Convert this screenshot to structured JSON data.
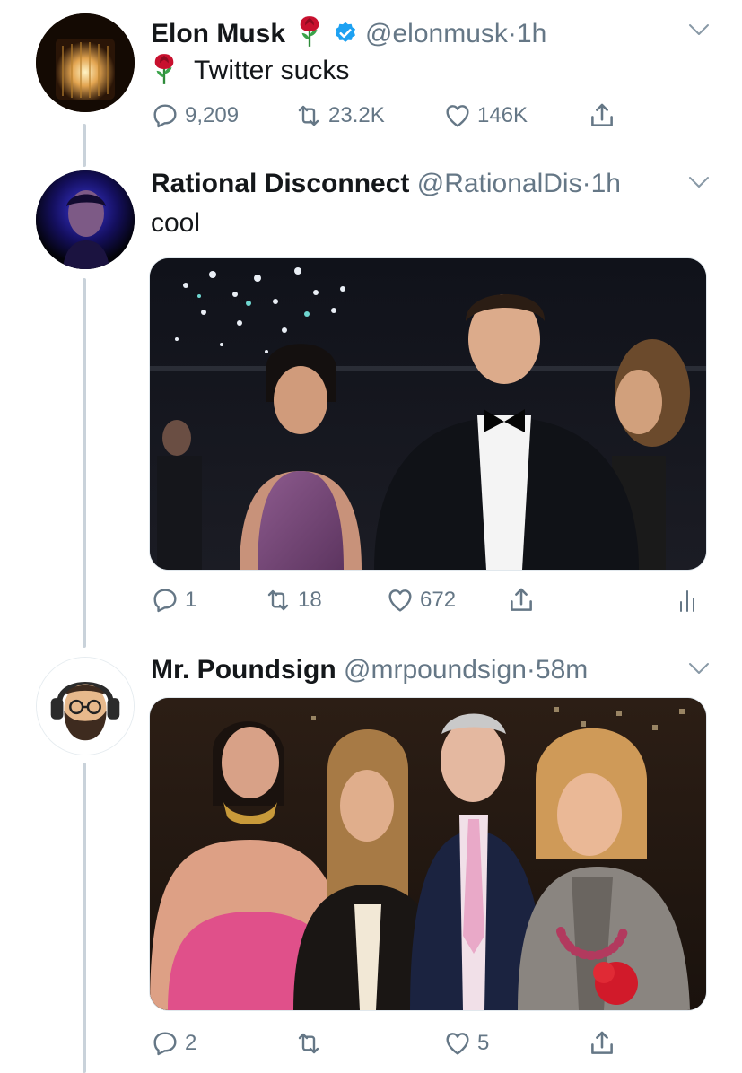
{
  "tweets": [
    {
      "name": "Elon Musk",
      "handle": "@elonmusk",
      "time": "1h",
      "verified": true,
      "text": "Twitter sucks",
      "replies": "9,209",
      "retweets": "23.2K",
      "likes": "146K"
    },
    {
      "name": "Rational Disconnect",
      "handle": "@RationalDis",
      "time": "1h",
      "text": "cool",
      "replies": "1",
      "retweets": "18",
      "likes": "672"
    },
    {
      "name": "Mr. Poundsign",
      "handle": "@mrpoundsign",
      "time": "58m",
      "replies": "2",
      "retweets": "",
      "likes": "5"
    }
  ],
  "separator": "·",
  "colors": {
    "text": "#14171a",
    "secondary": "#657786",
    "verified": "#1da1f2",
    "thread_line": "#c9d2da",
    "rose": "#c8102e"
  },
  "icons": [
    "rose-emoji",
    "verified-badge-icon",
    "chevron-down-icon",
    "reply-icon",
    "retweet-icon",
    "like-icon",
    "share-icon",
    "analytics-icon"
  ]
}
